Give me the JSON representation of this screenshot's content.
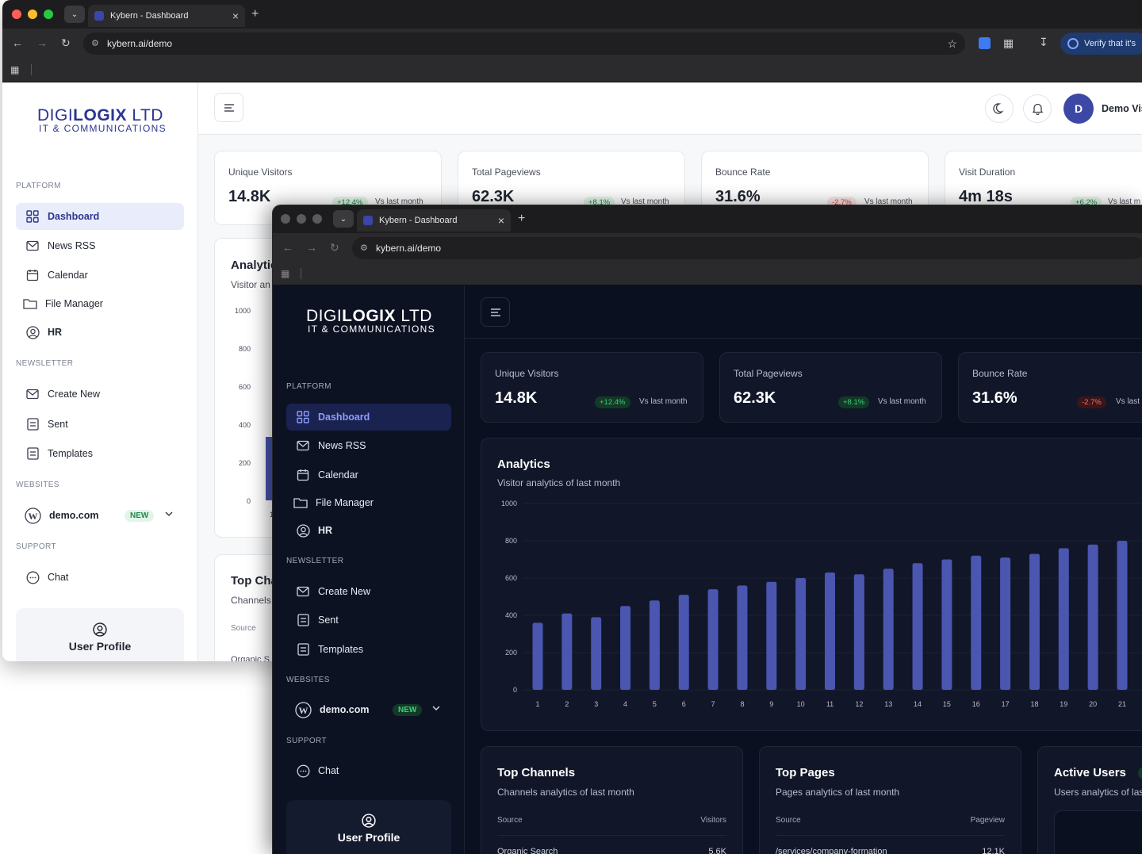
{
  "browser": {
    "tab_title": "Kybern - Dashboard",
    "url": "kybern.ai/demo",
    "extension_text": "Verify that it's"
  },
  "logo": {
    "name_light": "DIGI",
    "name_bold": "LOGIX",
    "name_suffix": " LTD",
    "tagline": "IT & COMMUNICATIONS"
  },
  "sidebar": {
    "sections": {
      "platform": "PLATFORM",
      "newsletter": "NEWSLETTER",
      "websites": "WEBSITES",
      "support": "SUPPORT"
    },
    "items": {
      "dashboard": "Dashboard",
      "news_rss": "News RSS",
      "calendar": "Calendar",
      "file_manager": "File Manager",
      "hr": "HR",
      "create_new": "Create New",
      "sent": "Sent",
      "templates": "Templates",
      "website": "demo.com",
      "website_badge": "NEW",
      "chat": "Chat"
    },
    "user_profile": "User Profile",
    "icons": [
      "dashboard-grid-icon",
      "envelope-icon",
      "calendar-icon",
      "folder-icon",
      "user-circle-icon",
      "envelope-icon",
      "document-icon",
      "document-icon",
      "wordpress-icon",
      "chevron-down-icon",
      "chat-bubble-icon",
      "user-circle-icon"
    ]
  },
  "header": {
    "avatar_initial": "D",
    "user_name": "Demo Vis"
  },
  "stats": [
    {
      "title": "Unique Visitors",
      "value": "14.8K",
      "delta": "+12.4%",
      "delta_kind": "up",
      "vs": "Vs last month"
    },
    {
      "title": "Total Pageviews",
      "value": "62.3K",
      "delta": "+8.1%",
      "delta_kind": "up",
      "vs": "Vs last month"
    },
    {
      "title": "Bounce Rate",
      "value": "31.6%",
      "delta": "-2.7%",
      "delta_kind": "down",
      "vs": "Vs last month"
    },
    {
      "title": "Visit Duration",
      "value": "4m 18s",
      "delta": "+6.2%",
      "delta_kind": "up",
      "vs": "Vs last m"
    }
  ],
  "dark_stats_vs": {
    "bounce": "Vs last"
  },
  "analytics": {
    "title": "Analytics",
    "subtitle": "Visitor analytics of last month",
    "light_title_clip": "Analytic",
    "light_subtitle_clip": "Visitor an"
  },
  "light_y_ticks": [
    "1000",
    "800",
    "600",
    "400",
    "200",
    "0"
  ],
  "light_x_first": "1",
  "chart_data": {
    "type": "bar",
    "title": "Analytics",
    "subtitle": "Visitor analytics of last month",
    "categories": [
      "1",
      "2",
      "3",
      "4",
      "5",
      "6",
      "7",
      "8",
      "9",
      "10",
      "11",
      "12",
      "13",
      "14",
      "15",
      "16",
      "17",
      "18",
      "19",
      "20",
      "21"
    ],
    "values": [
      360,
      410,
      390,
      450,
      480,
      510,
      540,
      560,
      580,
      600,
      630,
      620,
      650,
      680,
      700,
      720,
      710,
      730,
      760,
      780,
      800
    ],
    "yticks": [
      "1000",
      "800",
      "600",
      "400",
      "200",
      "0"
    ],
    "ylim": [
      0,
      1000
    ],
    "grid": true,
    "bar_color": "#4a56b0"
  },
  "top_channels": {
    "title": "Top Channels",
    "subtitle": "Channels analytics of last month",
    "col_source": "Source",
    "col_visitors": "Visitors",
    "row1_source": "Organic Search",
    "row1_value": "5.6K",
    "light_title_clip": "Top Cha",
    "light_subtitle_clip": "Channels",
    "light_row_clip": "Organic S"
  },
  "top_pages": {
    "title": "Top Pages",
    "subtitle": "Pages analytics of last month",
    "col_source": "Source",
    "col_views": "Pageview",
    "row1_source": "/services/company-formation",
    "row1_value": "12.1K"
  },
  "active_users": {
    "title": "Active Users",
    "subtitle": "Users analytics of las"
  },
  "colors": {
    "brand": "#2b3590",
    "dark_bg": "#0b1021",
    "bar": "#4a56b0",
    "up": "#1f8a4c",
    "down": "#d64545"
  }
}
